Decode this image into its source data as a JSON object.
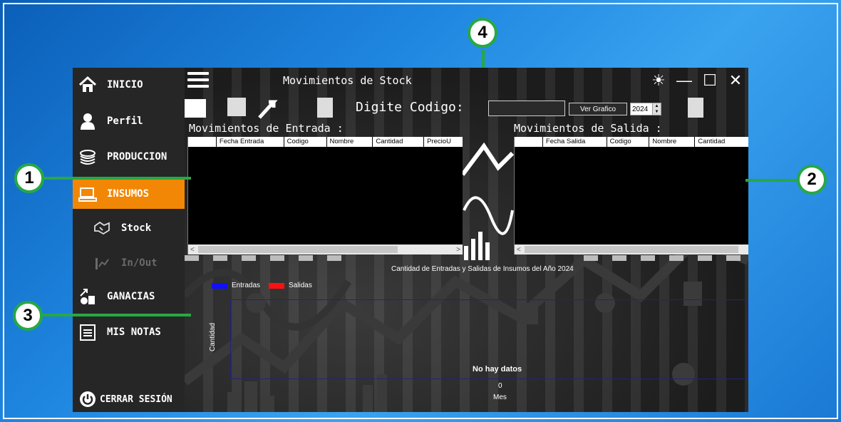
{
  "sidebar": {
    "items": [
      {
        "label": "INICIO",
        "icon": "home-icon"
      },
      {
        "label": "Perfil",
        "icon": "user-icon"
      },
      {
        "label": "PRODUCCION",
        "icon": "stack-icon"
      },
      {
        "label": "INSUMOS",
        "icon": "sewing-machine-icon",
        "active": true
      },
      {
        "label": "Stock",
        "icon": "handshake-icon",
        "sub": true
      },
      {
        "label": "In/Out",
        "icon": "chart-icon",
        "sub": true,
        "disabled": true
      },
      {
        "label": "GANACIAS",
        "icon": "money-growth-icon"
      },
      {
        "label": "MIS NOTAS",
        "icon": "notepad-icon"
      }
    ],
    "logout": {
      "label": "CERRAR SESIÓN",
      "icon": "power-icon"
    }
  },
  "window": {
    "title": "Movimientos de Stock",
    "controls": [
      "brightness-icon",
      "minimize-icon",
      "maximize-icon",
      "close-icon"
    ]
  },
  "toolbar": {
    "codigo_label": "Digite Codigo:",
    "codigo_value": "",
    "ver_grafico_label": "Ver Grafico",
    "year_value": "2024"
  },
  "entrada": {
    "title": "Movimientos de Entrada :",
    "columns": [
      "Fecha Entrada",
      "Codigo",
      "Nombre",
      "Cantidad",
      "PrecioU"
    ]
  },
  "salida": {
    "title": "Movimientos de Salida :",
    "columns": [
      "Fecha Salida",
      "Codigo",
      "Nombre",
      "Cantidad"
    ]
  },
  "chart": {
    "title": "Cantidad de Entradas y Salidas de Insumos del Año 2024",
    "legend": [
      {
        "name": "Entradas",
        "color": "#1010ff"
      },
      {
        "name": "Salidas",
        "color": "#ff1010"
      }
    ],
    "ylabel": "Cantidad",
    "xlabel": "Mes",
    "empty_message": "No hay datos",
    "x_tick": "0"
  },
  "chart_data": {
    "type": "bar",
    "title": "Cantidad de Entradas y Salidas de Insumos del Año 2024",
    "xlabel": "Mes",
    "ylabel": "Cantidad",
    "categories": [],
    "series": [
      {
        "name": "Entradas",
        "values": []
      },
      {
        "name": "Salidas",
        "values": []
      }
    ],
    "legend": "top-left"
  },
  "annotations": [
    "1",
    "2",
    "3",
    "4"
  ],
  "colors": {
    "accent": "#f28705",
    "callout": "#27a844",
    "sidebar": "#262626"
  }
}
